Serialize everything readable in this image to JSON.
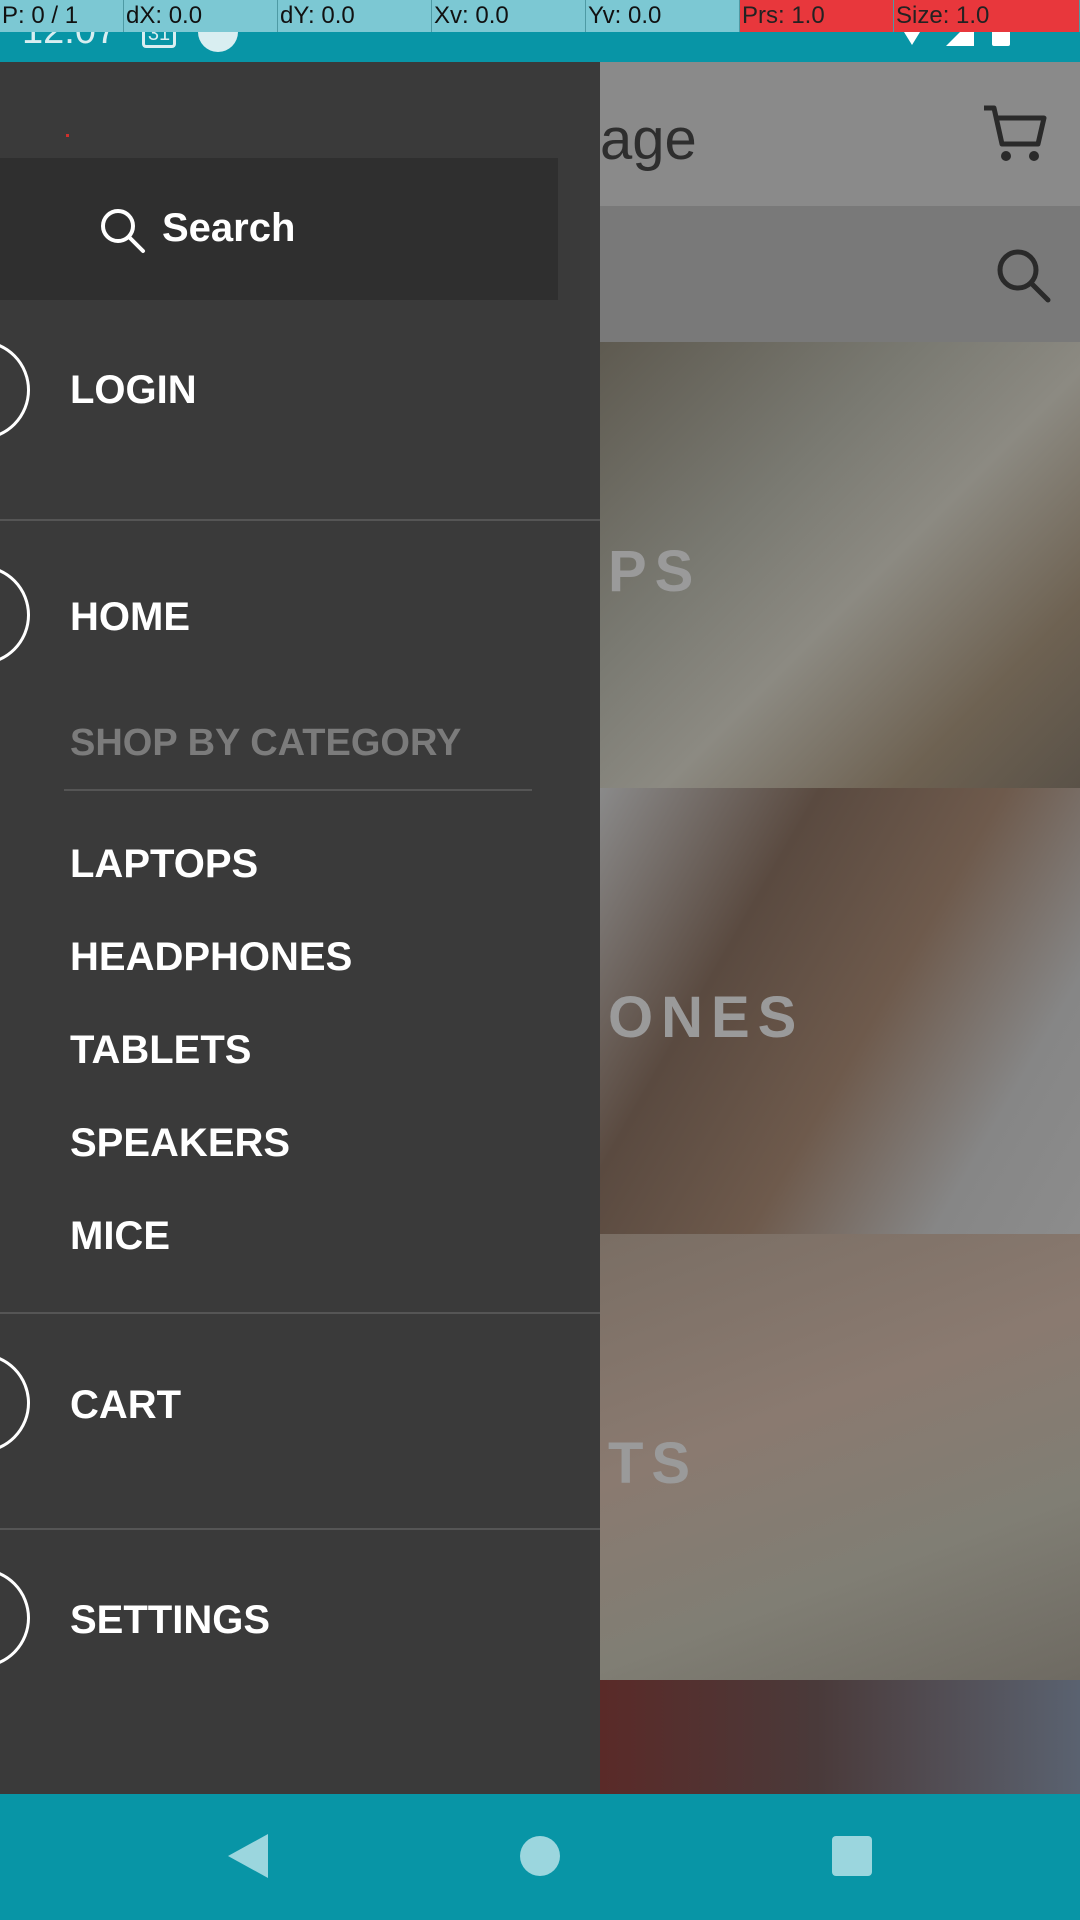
{
  "debug_overlay": {
    "cells": [
      "P: 0 / 1",
      "dX: 0.0",
      "dY: 0.0",
      "Xv: 0.0",
      "Yv: 0.0",
      "Prs: 1.0",
      "Size: 1.0"
    ]
  },
  "status_bar": {
    "time": "12:07",
    "calendar_day": "31"
  },
  "app": {
    "title_fragment": "age",
    "category_tiles": [
      {
        "label_fragment": "PS"
      },
      {
        "label_fragment": "ONES"
      },
      {
        "label_fragment": "TS"
      },
      {
        "label_fragment": ""
      }
    ]
  },
  "drawer": {
    "search_label": "Search",
    "login_label": "LOGIN",
    "home_label": "HOME",
    "section_header": "SHOP BY CATEGORY",
    "categories": [
      "LAPTOPS",
      "HEADPHONES",
      "TABLETS",
      "SPEAKERS",
      "MICE"
    ],
    "cart_label": "CART",
    "settings_label": "SETTINGS"
  },
  "colors": {
    "status_bar": "#0895a6",
    "drawer_bg": "#3a3a3a",
    "drawer_search_bg": "#2f2f2f",
    "section_header": "#7b7b7b",
    "debug_bar": "#7cc8d3",
    "debug_alert": "#e8373c"
  },
  "icons": {
    "toolbar_cart": "cart-icon",
    "toolbar_search": "search-icon",
    "drawer_search": "search-icon",
    "nav_back": "back-triangle-icon",
    "nav_home": "home-circle-icon",
    "nav_recents": "recents-square-icon"
  }
}
